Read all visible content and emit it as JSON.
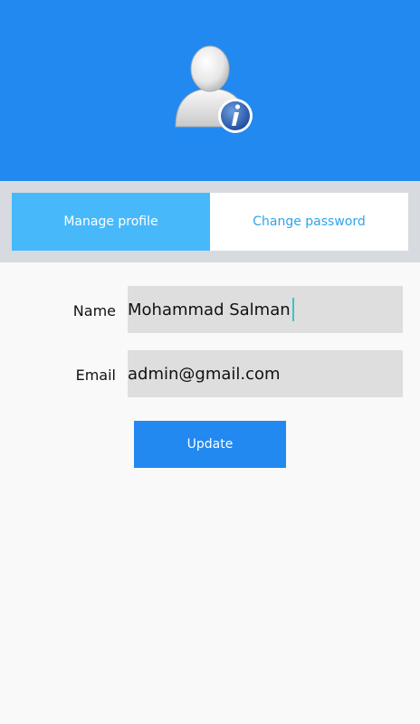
{
  "header": {
    "icon": "user-info-icon",
    "background_color": "#2189f0"
  },
  "tabs": [
    {
      "label": "Manage profile",
      "active": true
    },
    {
      "label": "Change password",
      "active": false
    }
  ],
  "form": {
    "name_label": "Name",
    "name_value": "Mohammad Salman",
    "email_label": "Email",
    "email_value": "admin@gmail.com",
    "update_label": "Update"
  },
  "colors": {
    "accent": "#2189f0",
    "tab_active": "#47b9fb",
    "tab_inactive_text": "#2ea4e8",
    "field_bg": "#dedede"
  }
}
